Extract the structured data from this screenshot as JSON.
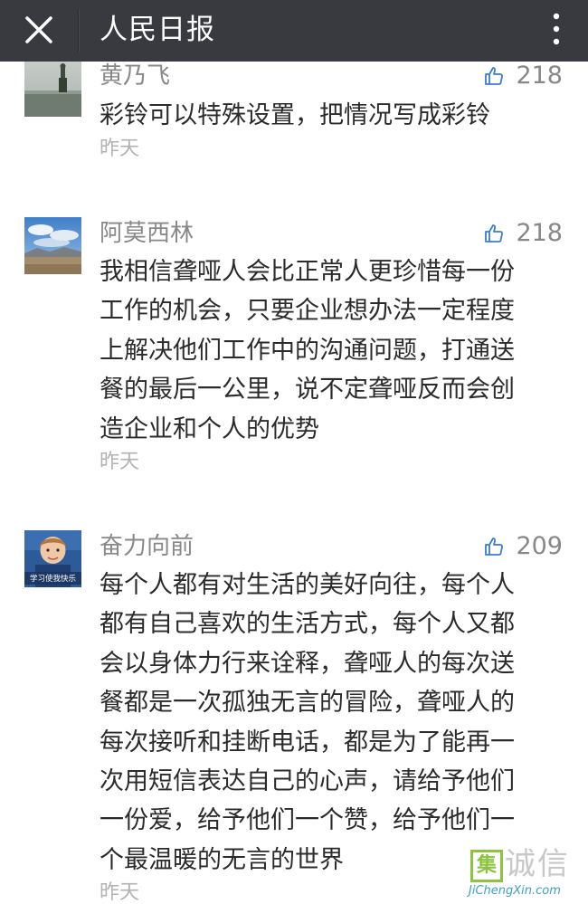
{
  "header": {
    "title": "人民日报",
    "close_icon": "close-icon",
    "more_icon": "more-vertical-icon"
  },
  "comments": [
    {
      "author": "黄乃飞",
      "likes": "218",
      "lines": [
        "彩铃可以特殊设置，把情况写成彩铃"
      ],
      "time": "昨天"
    },
    {
      "author": "阿莫西林",
      "likes": "218",
      "lines": [
        "我相信聋哑人会比正常人更珍惜每一份",
        "工作的机会，只要企业想办法一定程度",
        "上解决他们工作中的沟通问题，打通送",
        "餐的最后一公里，说不定聋哑反而会创",
        "造企业和个人的优势"
      ],
      "time": "昨天"
    },
    {
      "author": "奋力向前",
      "likes": "209",
      "avatar_caption": "学习使我快乐",
      "lines": [
        "每个人都有对生活的美好向往，每个人",
        "都有自己喜欢的生活方式，每个人又都",
        "会以身体力行来诠释，聋哑人的每次送",
        "餐都是一次孤独无言的冒险，聋哑人的",
        "每次接听和挂断电话，都是为了能再一",
        "次用短信表达自己的心声，请给予他们",
        "一份爱，给予他们一个赞，给予他们一",
        "个最温暖的无言的世界"
      ],
      "time": "昨天"
    }
  ],
  "watermark": {
    "box_char": "集",
    "chars": "诚信",
    "url": "JiChengXin.com"
  },
  "colors": {
    "header_bg": "#393a3f",
    "text": "#2b2b2b",
    "meta": "#888888",
    "time": "#b2b2b2",
    "watermark_green": "#8cc43f"
  }
}
